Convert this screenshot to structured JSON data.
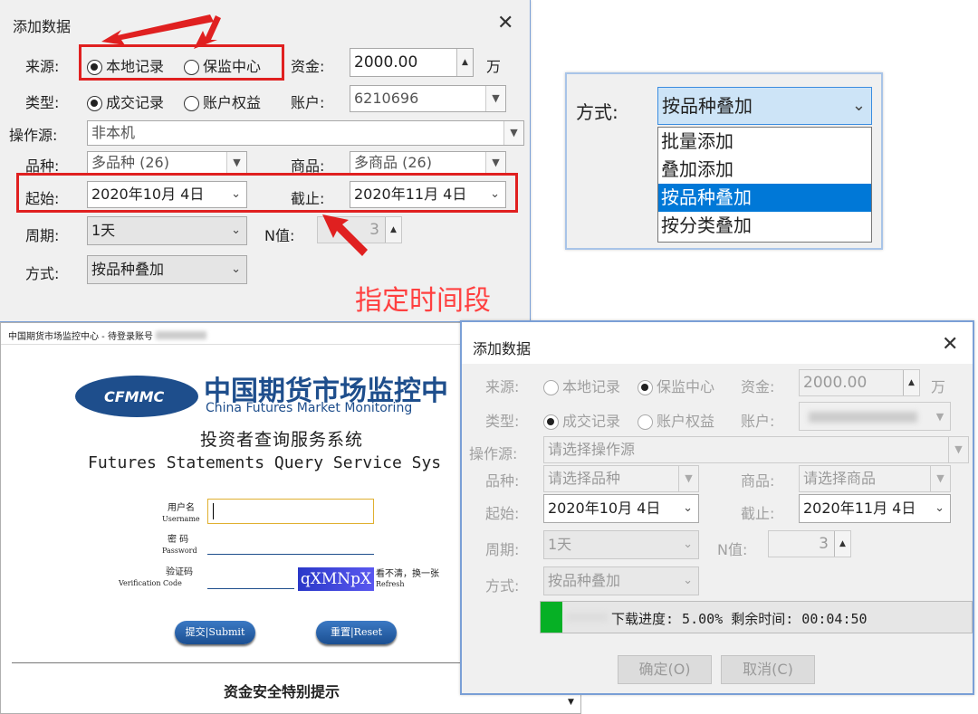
{
  "dialog1": {
    "title": "添加数据",
    "close": "✕",
    "source_label": "来源:",
    "source_opt1": "本地记录",
    "source_opt2": "保监中心",
    "capital_label": "资金:",
    "capital_value": "2000.00",
    "capital_unit": "万",
    "type_label": "类型:",
    "type_opt1": "成交记录",
    "type_opt2": "账户权益",
    "account_label": "账户:",
    "account_value": "6210696",
    "operator_label": "操作源:",
    "operator_value": "非本机",
    "variety_label": "品种:",
    "variety_value": "多品种 (26)",
    "goods_label": "商品:",
    "goods_value": "多商品 (26)",
    "start_label": "起始:",
    "start_value": "2020年10月  4日",
    "end_label": "截止:",
    "end_value": "2020年11月  4日",
    "period_label": "周期:",
    "period_value": "1天",
    "n_label": "N值:",
    "n_value": "3",
    "mode_label": "方式:",
    "mode_value": "按品种叠加"
  },
  "annotation": "指定时间段",
  "dropdown_panel": {
    "label": "方式:",
    "selected": "按品种叠加",
    "options": [
      "批量添加",
      "叠加添加",
      "按品种叠加",
      "按分类叠加"
    ],
    "highlight_index": 2
  },
  "login": {
    "window_title": "中国期货市场监控中心 - 待登录账号",
    "logo_text": "CFMMC",
    "cn_name": "中国期货市场监控中",
    "en_name": "China Futures Market Monitoring",
    "sys_cn": "投资者查询服务系统",
    "sys_en": "Futures Statements Query Service Sys",
    "user_cn": "用户名",
    "user_en": "Username",
    "pass_cn": "密  码",
    "pass_en": "Password",
    "code_cn": "验证码",
    "code_en": "Verification Code",
    "captcha": "qXMNpX",
    "refresh_cn": "看不清，换一张",
    "refresh_en": "Refresh",
    "submit": "提交|Submit",
    "reset": "重置|Reset",
    "notice": "资金安全特别提示"
  },
  "dialog2": {
    "title": "添加数据",
    "close": "✕",
    "source_label": "来源:",
    "source_opt1": "本地记录",
    "source_opt2": "保监中心",
    "capital_label": "资金:",
    "capital_value": "2000.00",
    "capital_unit": "万",
    "type_label": "类型:",
    "type_opt1": "成交记录",
    "type_opt2": "账户权益",
    "account_label": "账户:",
    "operator_label": "操作源:",
    "operator_placeholder": "请选择操作源",
    "variety_label": "品种:",
    "variety_placeholder": "请选择品种",
    "goods_label": "商品:",
    "goods_placeholder": "请选择商品",
    "start_label": "起始:",
    "start_value": "2020年10月  4日",
    "end_label": "截止:",
    "end_value": "2020年11月  4日",
    "period_label": "周期:",
    "period_value": "1天",
    "n_label": "N值:",
    "n_value": "3",
    "mode_label": "方式:",
    "mode_value": "按品种叠加",
    "progress_text": "下载进度: 5.00%    剩余时间: 00:04:50",
    "progress_fraction": 0.05,
    "ok": "确定(O)",
    "cancel": "取消(C)"
  }
}
